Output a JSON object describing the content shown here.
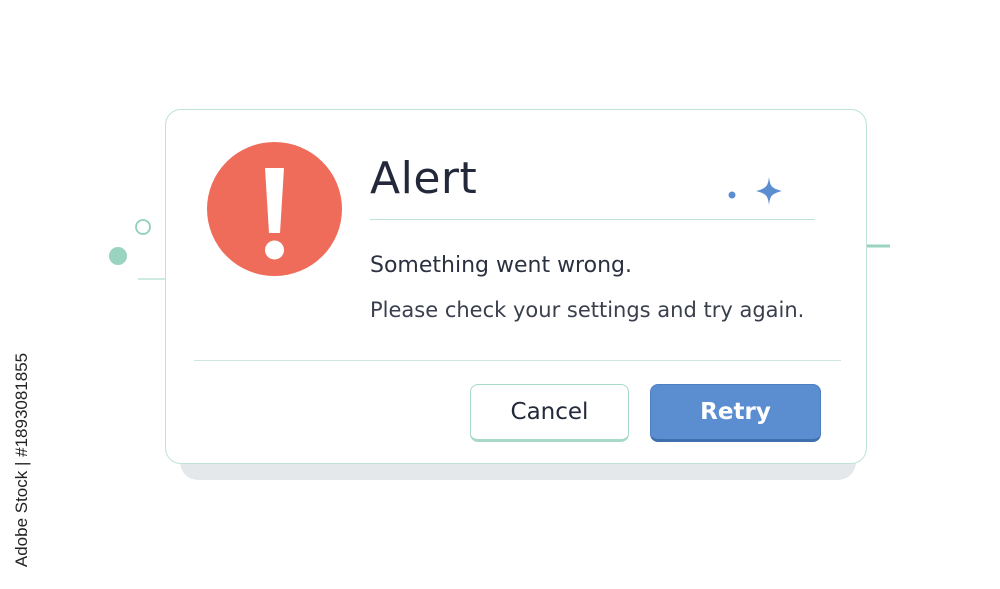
{
  "dialog": {
    "title": "Alert",
    "message_primary": "Something went wrong.",
    "message_secondary": "Please check your settings and try again.",
    "icon": "exclamation-circle-icon",
    "buttons": {
      "cancel_label": "Cancel",
      "retry_label": "Retry"
    }
  },
  "watermark": {
    "text": "Adobe Stock | #1893081855"
  },
  "colors": {
    "alert_red": "#ef6c5a",
    "primary_blue": "#5b8ed1",
    "mint_accent": "#a8d9c8",
    "title_text": "#23293a"
  }
}
